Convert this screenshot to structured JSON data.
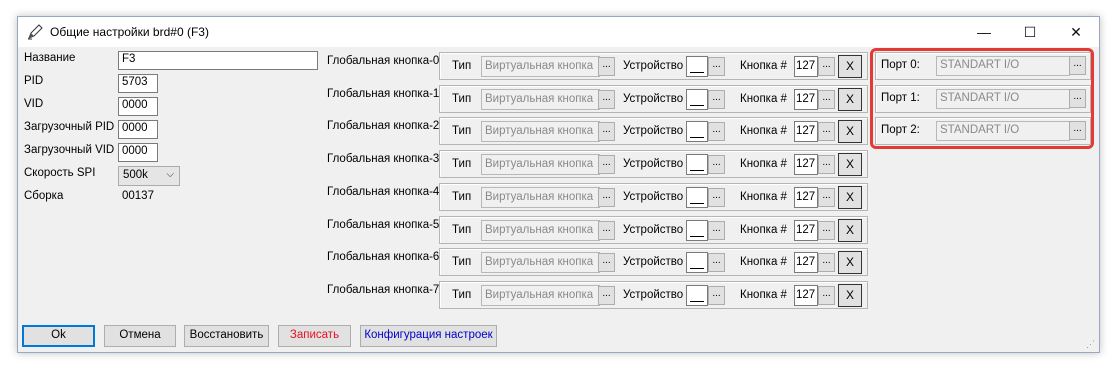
{
  "window": {
    "title": "Общие настройки brd#0 (F3)",
    "minimize": "—",
    "maximize": "☐",
    "close": "✕"
  },
  "props": {
    "name_label": "Название",
    "name_value": "F3",
    "pid_label": "PID",
    "pid_value": "5703",
    "vid_label": "VID",
    "vid_value": "0000",
    "boot_pid_label": "Загрузочный PID",
    "boot_pid_value": "0000",
    "boot_vid_label": "Загрузочный VID",
    "boot_vid_value": "0000",
    "spi_label": "Скорость SPI",
    "spi_value": "500k",
    "build_label": "Сборка",
    "build_value": "00137"
  },
  "global_buttons": [
    {
      "label": "Глобальная кнопка-0",
      "type_label": "Тип",
      "type_value": "Виртуальная кнопка",
      "device_label": "Устройство",
      "button_label": "Кнопка #",
      "number": "127",
      "x": "X"
    },
    {
      "label": "Глобальная кнопка-1",
      "type_label": "Тип",
      "type_value": "Виртуальная кнопка",
      "device_label": "Устройство",
      "button_label": "Кнопка #",
      "number": "127",
      "x": "X"
    },
    {
      "label": "Глобальная кнопка-2",
      "type_label": "Тип",
      "type_value": "Виртуальная кнопка",
      "device_label": "Устройство",
      "button_label": "Кнопка #",
      "number": "127",
      "x": "X"
    },
    {
      "label": "Глобальная кнопка-3",
      "type_label": "Тип",
      "type_value": "Виртуальная кнопка",
      "device_label": "Устройство",
      "button_label": "Кнопка #",
      "number": "127",
      "x": "X"
    },
    {
      "label": "Глобальная кнопка-4",
      "type_label": "Тип",
      "type_value": "Виртуальная кнопка",
      "device_label": "Устройство",
      "button_label": "Кнопка #",
      "number": "127",
      "x": "X"
    },
    {
      "label": "Глобальная кнопка-5",
      "type_label": "Тип",
      "type_value": "Виртуальная кнопка",
      "device_label": "Устройство",
      "button_label": "Кнопка #",
      "number": "127",
      "x": "X"
    },
    {
      "label": "Глобальная кнопка-6",
      "type_label": "Тип",
      "type_value": "Виртуальная кнопка",
      "device_label": "Устройство",
      "button_label": "Кнопка #",
      "number": "127",
      "x": "X"
    },
    {
      "label": "Глобальная кнопка-7",
      "type_label": "Тип",
      "type_value": "Виртуальная кнопка",
      "device_label": "Устройство",
      "button_label": "Кнопка #",
      "number": "127",
      "x": "X"
    }
  ],
  "ports": [
    {
      "label": "Порт 0:",
      "value": "STANDART I/O"
    },
    {
      "label": "Порт 1:",
      "value": "STANDART I/O"
    },
    {
      "label": "Порт 2:",
      "value": "STANDART I/O"
    }
  ],
  "ellipsis": "...",
  "combo_arrow": "⌵",
  "bottom": {
    "ok": "Ok",
    "cancel": "Отмена",
    "restore": "Восстановить",
    "write": "Записать",
    "config": "Конфигурация настроек"
  },
  "colors": {
    "highlight": "#e53935",
    "write_text": "#e81123",
    "config_text": "#0000cc",
    "accent": "#0078d7"
  }
}
